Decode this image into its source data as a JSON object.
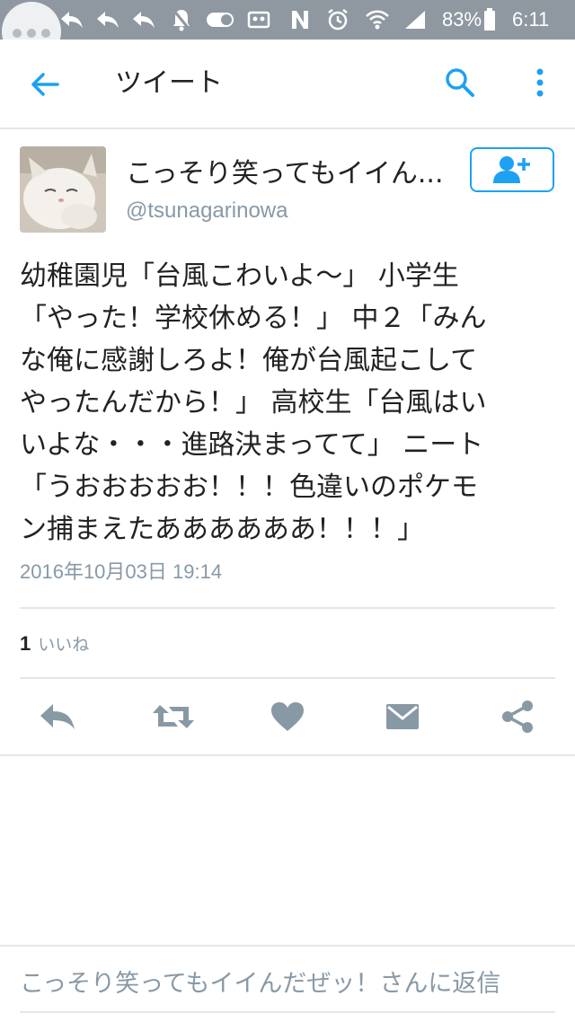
{
  "status_bar": {
    "battery_percent": "83%",
    "time": "6:11",
    "icons": [
      "reply-icon",
      "reply-icon",
      "reply-icon",
      "reply-icon",
      "mute-icon",
      "toggle-icon",
      "voicemail-icon",
      "n-icon",
      "alarm-icon",
      "wifi-icon",
      "signal-icon",
      "battery-icon"
    ]
  },
  "appbar": {
    "title": "ツイート",
    "back_icon": "arrow-left-icon",
    "search_icon": "search-icon",
    "more_icon": "more-vertical-icon"
  },
  "tweet": {
    "display_name": "こっそり笑ってもイイん...",
    "handle": "@tsunagarinowa",
    "text": "幼稚園児「台風こわいよ〜」 小学生\n「やった！学校休める！」 中２「みん\nな俺に感謝しろよ！俺が台風起こして\nやったんだから！」 高校生「台風はい\nいよな・・・進路決まってて」 ニート\n「うおおおおお！！！色違いのポケモ\nン捕まえたああああああ！！！」",
    "timestamp": "2016年10月03日 19:14",
    "likes_count": "1",
    "likes_label": "いいね"
  },
  "actions": [
    {
      "name": "reply",
      "icon": "reply-icon"
    },
    {
      "name": "retweet",
      "icon": "retweet-icon"
    },
    {
      "name": "like",
      "icon": "heart-icon"
    },
    {
      "name": "message",
      "icon": "mail-icon"
    },
    {
      "name": "share",
      "icon": "share-icon"
    }
  ],
  "reply_box": {
    "placeholder": "こっそり笑ってもイイんだぜッ！さんに返信"
  },
  "colors": {
    "accent": "#1da1f2",
    "status_bar": "#8f98a1",
    "secondary_text": "#8899a6",
    "icon_gray": "#8899a6",
    "divider": "#e1e8ed"
  }
}
